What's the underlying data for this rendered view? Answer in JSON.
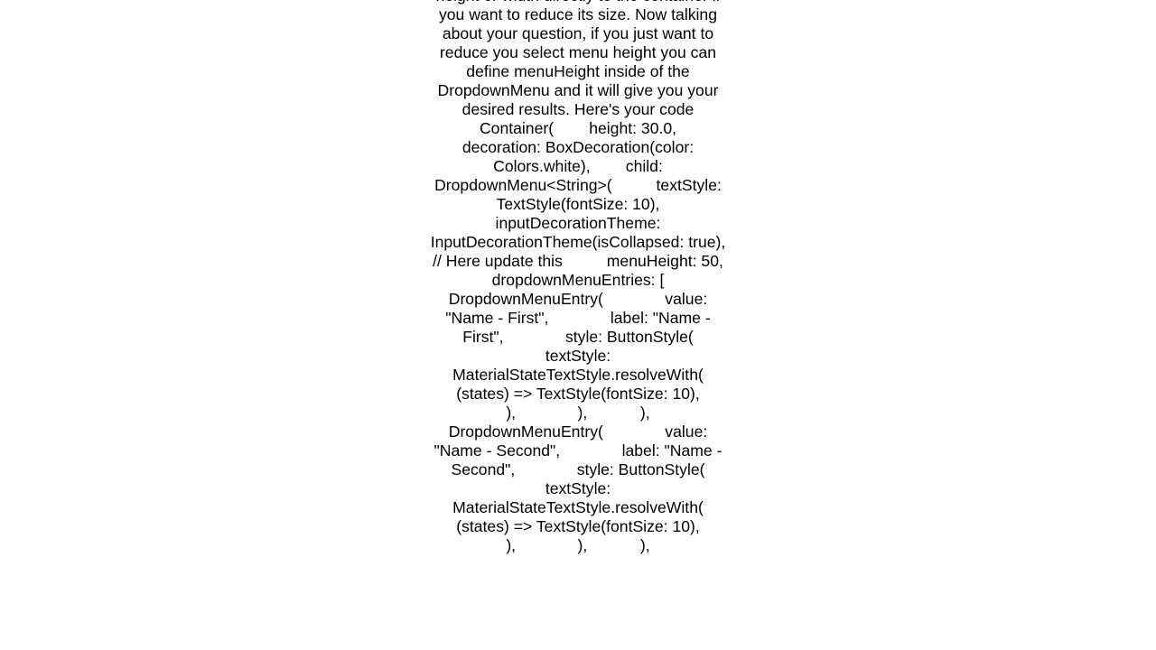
{
  "page": {
    "background_color": "#ffffff",
    "text_color": "#000000",
    "alignment": "center"
  },
  "answer": {
    "body_text": "height or width directly to the container if you want to reduce its size. Now talking about your question, if you just want to reduce you select menu height you can define menuHeight inside of the DropdownMenu and it will give you your desired results. Here's your code Container(        height: 30.0,          decoration: BoxDecoration(color: Colors.white),        child: DropdownMenu<String>(          textStyle: TextStyle(fontSize: 10),          inputDecorationTheme: InputDecorationTheme(isCollapsed: true),          // Here update this          menuHeight: 50,          dropdownMenuEntries: [            DropdownMenuEntry(              value: \"Name - First\",              label: \"Name - First\",              style: ButtonStyle(                textStyle: MaterialStateTextStyle.resolveWith(                  (states) => TextStyle(fontSize: 10),                ),              ),            ),            DropdownMenuEntry(              value: \"Name - Second\",              label: \"Name - Second\",              style: ButtonStyle(                textStyle: MaterialStateTextStyle.resolveWith(                  (states) => TextStyle(fontSize: 10),                ),              ),            ),",
    "visible_lines": [
      "height or width directly to the",
      "container if you want to reduce its",
      "size. Now talking about your question,",
      "if you just want to reduce you select",
      "menu height you can define menuHeight",
      "inside of the DropdownMenu and it will",
      "give you your desired results. Here's",
      "your code Container(        height:",
      "30.0,          decoration:",
      "BoxDecoration(color: Colors.white),",
      "child: DropdownMenu<String>(",
      "textStyle: TextStyle(fontSize: 10),",
      "inputDecorationTheme:",
      "InputDecorationTheme(isCollapsed: true),",
      "// Here update this",
      "menuHeight: 50,",
      "dropdownMenuEntries: [",
      "DropdownMenuEntry(",
      "value: \"Name - First\",",
      "label: \"Name - First\",",
      "style: ButtonStyle(",
      "textStyle:",
      "MaterialStateTextStyle.resolveWith(",
      "(states) => TextStyle(fontSize: 10),",
      "),                ),                ),",
      "DropdownMenuEntry(",
      "value: \"Name - Second\",",
      "label: \"Name - Second\",",
      "style: ButtonStyle(",
      "textStyle:",
      "MaterialStateTextStyle.resolveWith(",
      "(states) => TextStyle(fontSize: 10),"
    ]
  }
}
